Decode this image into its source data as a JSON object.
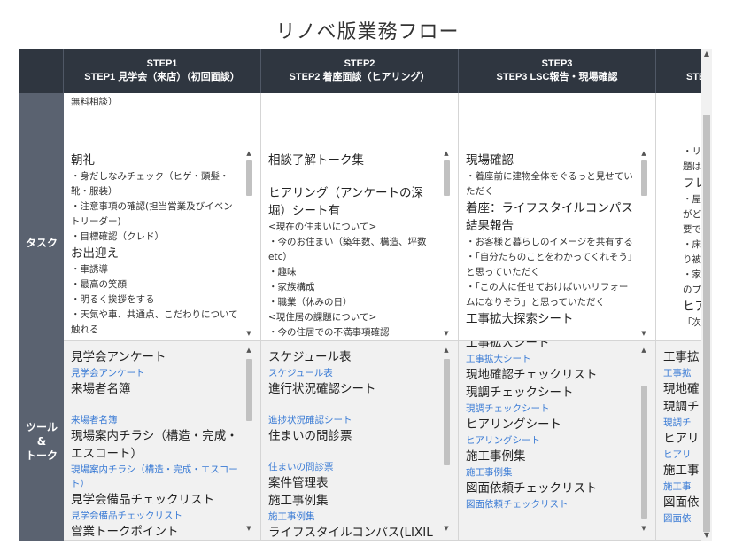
{
  "title": "リノベ版業務フロー",
  "columns": [
    {
      "step": "STEP1",
      "label": "STEP1 見学会（来店）（初回面談）"
    },
    {
      "step": "STEP2",
      "label": "STEP2 着座面談（ヒアリング）"
    },
    {
      "step": "STEP3",
      "label": "STEP3 LSC報告・現場確認"
    },
    {
      "step": "STE",
      "label": "STE"
    }
  ],
  "row_labels": {
    "task": "タスク",
    "tools_1": "ツール",
    "tools_2": "&",
    "tools_3": "トーク"
  },
  "top_row": {
    "col1": "無料相談）"
  },
  "tasks": {
    "col1": [
      {
        "t": "big",
        "v": "朝礼"
      },
      {
        "t": "small",
        "v": "・身だしなみチェック（ヒゲ・頭髪・靴・服装）"
      },
      {
        "t": "small",
        "v": "・注意事項の確認(担当営業及びイベントリーダー)"
      },
      {
        "t": "small",
        "v": "・目標確認（クレド）"
      },
      {
        "t": "big",
        "v": "お出迎え"
      },
      {
        "t": "small",
        "v": "・車誘導"
      },
      {
        "t": "small",
        "v": "・最高の笑顔"
      },
      {
        "t": "small",
        "v": "・明るく挨拶をする"
      },
      {
        "t": "small",
        "v": "・天気や車、共通点、こだわりについて触れる"
      }
    ],
    "col2": [
      {
        "t": "big",
        "v": "相談了解トーク集"
      },
      {
        "t": "gap",
        "v": ""
      },
      {
        "t": "big",
        "v": "ヒアリング（アンケートの深堀）シート有"
      },
      {
        "t": "small",
        "v": "<現在の住まいについて>"
      },
      {
        "t": "small",
        "v": "・今のお住まい（築年数、構造、坪数etc）"
      },
      {
        "t": "small",
        "v": "・趣味"
      },
      {
        "t": "small",
        "v": "・家族構成"
      },
      {
        "t": "small",
        "v": "・職業（休みの日）"
      },
      {
        "t": "small",
        "v": "<現住居の課題について>"
      },
      {
        "t": "small",
        "v": "・今の住居での不満事項確認"
      }
    ],
    "col3": [
      {
        "t": "big",
        "v": "現場確認"
      },
      {
        "t": "small",
        "v": "・着座前に建物全体をぐるっと見せていただく"
      },
      {
        "t": "big",
        "v": "着座：ライフスタイルコンパス結果報告"
      },
      {
        "t": "small",
        "v": "・お客様と暮らしのイメージを共有する"
      },
      {
        "t": "small",
        "v": "・「自分たちのことをわかってくれそう」と思っていただく"
      },
      {
        "t": "small",
        "v": "・「この人に任せておけばいいリフォームになりそう」と思っていただく"
      },
      {
        "t": "big",
        "v": "工事拡大探索シート"
      }
    ],
    "col4": [
      {
        "t": "small",
        "v": "・リフォー"
      },
      {
        "t": "small",
        "v": "題はない"
      },
      {
        "t": "big",
        "v": "フレー"
      },
      {
        "t": "small",
        "v": "・屋根裏"
      },
      {
        "t": "small",
        "v": "がどのよ"
      },
      {
        "t": "small",
        "v": "要ですの"
      },
      {
        "t": "small",
        "v": "・床下確"
      },
      {
        "t": "small",
        "v": "り被害の"
      },
      {
        "t": "small",
        "v": "・家具の"
      },
      {
        "t": "small",
        "v": "のプラン"
      },
      {
        "t": "big",
        "v": "ヒアリ"
      },
      {
        "t": "small",
        "v": "「次回こ"
      }
    ]
  },
  "tools": {
    "col1": [
      {
        "t": "big",
        "v": "見学会アンケート"
      },
      {
        "t": "blue",
        "v": "見学会アンケート"
      },
      {
        "t": "big",
        "v": "来場者名簿"
      },
      {
        "t": "gap",
        "v": ""
      },
      {
        "t": "blue",
        "v": "来場者名簿"
      },
      {
        "t": "big",
        "v": "現場案内チラシ（構造・完成・エスコート）"
      },
      {
        "t": "blue",
        "v": "現場案内チラシ（構造・完成・エスコート）"
      },
      {
        "t": "big",
        "v": "見学会備品チェックリスト"
      },
      {
        "t": "blue",
        "v": "見学会備品チェックリスト"
      },
      {
        "t": "big",
        "v": "営業トークポイント"
      }
    ],
    "col2": [
      {
        "t": "big",
        "v": "スケジュール表"
      },
      {
        "t": "blue",
        "v": "スケジュール表"
      },
      {
        "t": "big",
        "v": "進行状況確認シート"
      },
      {
        "t": "gap",
        "v": ""
      },
      {
        "t": "blue",
        "v": "進捗状況確認シート"
      },
      {
        "t": "big",
        "v": "住まいの問診票"
      },
      {
        "t": "gap",
        "v": ""
      },
      {
        "t": "blue",
        "v": "住まいの問診票"
      },
      {
        "t": "big",
        "v": "案件管理表"
      },
      {
        "t": "big",
        "v": "施工事例集"
      },
      {
        "t": "blue",
        "v": "施工事例集"
      },
      {
        "t": "big",
        "v": "ライフスタイルコンパス(LIXILツール)"
      }
    ],
    "col3": [
      {
        "t": "big",
        "v": "工事拡大シート"
      },
      {
        "t": "blue",
        "v": "工事拡大シート"
      },
      {
        "t": "big",
        "v": "現地確認チェックリスト"
      },
      {
        "t": "big",
        "v": "現調チェックシート"
      },
      {
        "t": "blue",
        "v": "現調チェックシート"
      },
      {
        "t": "big",
        "v": "ヒアリングシート"
      },
      {
        "t": "blue",
        "v": "ヒアリングシート"
      },
      {
        "t": "big",
        "v": "施工事例集"
      },
      {
        "t": "blue",
        "v": "施工事例集"
      },
      {
        "t": "big",
        "v": "図面依頼チェックリスト"
      },
      {
        "t": "blue",
        "v": "図面依頼チェックリスト"
      }
    ],
    "col4": [
      {
        "t": "big",
        "v": "工事拡"
      },
      {
        "t": "blue",
        "v": "工事拡"
      },
      {
        "t": "big",
        "v": "現地確"
      },
      {
        "t": "big",
        "v": "現調チ"
      },
      {
        "t": "blue",
        "v": "現調チ"
      },
      {
        "t": "big",
        "v": "ヒアリ"
      },
      {
        "t": "blue",
        "v": "ヒアリ"
      },
      {
        "t": "big",
        "v": "施工事"
      },
      {
        "t": "blue",
        "v": "施工事"
      },
      {
        "t": "big",
        "v": "図面依"
      },
      {
        "t": "blue",
        "v": "図面依"
      }
    ]
  }
}
